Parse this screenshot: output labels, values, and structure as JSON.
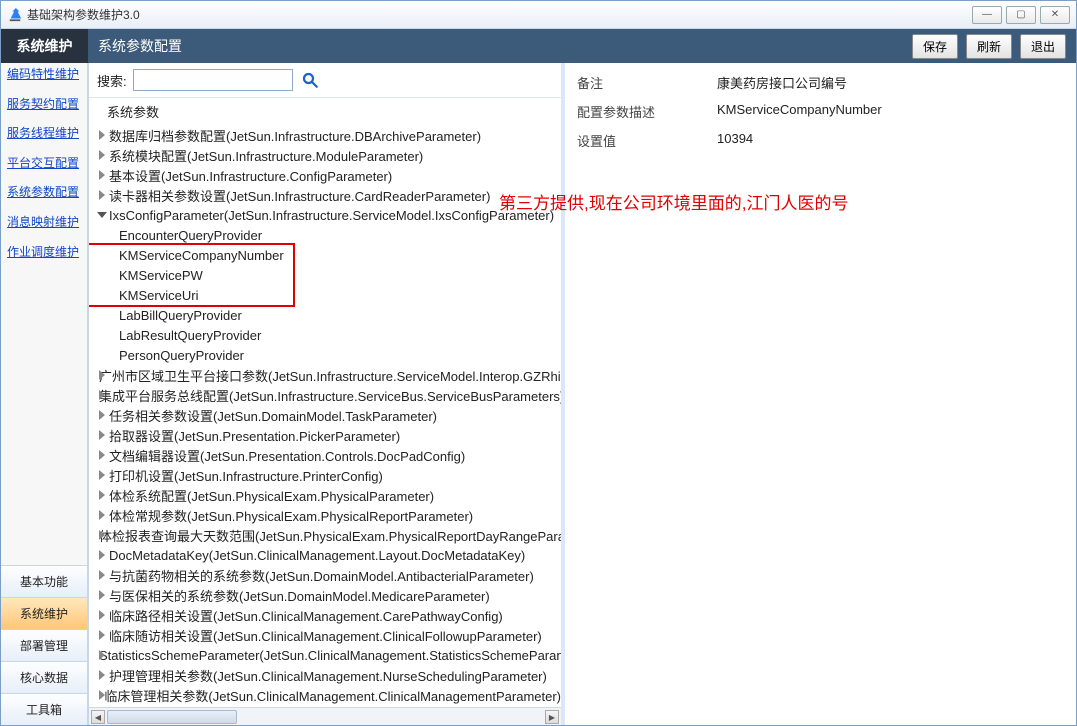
{
  "window": {
    "title": "基础架构参数维护3.0"
  },
  "header": {
    "section": "系统维护",
    "title": "系统参数配置",
    "buttons": {
      "save": "保存",
      "refresh": "刷新",
      "exit": "退出"
    }
  },
  "sidebar": {
    "links": [
      "编码特性维护",
      "服务契约配置",
      "服务线程维护",
      "平台交互配置",
      "系统参数配置",
      "消息映射维护",
      "作业调度维护"
    ],
    "tabs": [
      "基本功能",
      "系统维护",
      "部署管理",
      "核心数据",
      "工具箱"
    ],
    "active_tab_index": 1
  },
  "search": {
    "label": "搜索:",
    "value": ""
  },
  "tree": {
    "root_label": "系统参数",
    "nodes": [
      {
        "label": "数据库归档参数配置(JetSun.Infrastructure.DBArchiveParameter)",
        "expanded": false,
        "level": 1
      },
      {
        "label": "系统模块配置(JetSun.Infrastructure.ModuleParameter)",
        "expanded": false,
        "level": 1
      },
      {
        "label": "基本设置(JetSun.Infrastructure.ConfigParameter)",
        "expanded": false,
        "level": 1
      },
      {
        "label": "读卡器相关参数设置(JetSun.Infrastructure.CardReaderParameter)",
        "expanded": false,
        "level": 1
      },
      {
        "label": "IxsConfigParameter(JetSun.Infrastructure.ServiceModel.IxsConfigParameter)",
        "expanded": true,
        "level": 1,
        "children": [
          {
            "label": "EncounterQueryProvider",
            "level": 2
          },
          {
            "label": "KMServiceCompanyNumber",
            "level": 2
          },
          {
            "label": "KMServicePW",
            "level": 2
          },
          {
            "label": "KMServiceUri",
            "level": 2
          },
          {
            "label": "LabBillQueryProvider",
            "level": 2
          },
          {
            "label": "LabResultQueryProvider",
            "level": 2
          },
          {
            "label": "PersonQueryProvider",
            "level": 2
          }
        ]
      },
      {
        "label": "广州市区域卫生平台接口参数(JetSun.Infrastructure.ServiceModel.Interop.GZRhin",
        "expanded": false,
        "level": 1
      },
      {
        "label": "集成平台服务总线配置(JetSun.Infrastructure.ServiceBus.ServiceBusParameters)",
        "expanded": false,
        "level": 1
      },
      {
        "label": "任务相关参数设置(JetSun.DomainModel.TaskParameter)",
        "expanded": false,
        "level": 1
      },
      {
        "label": "拾取器设置(JetSun.Presentation.PickerParameter)",
        "expanded": false,
        "level": 1
      },
      {
        "label": "文档编辑器设置(JetSun.Presentation.Controls.DocPadConfig)",
        "expanded": false,
        "level": 1
      },
      {
        "label": "打印机设置(JetSun.Infrastructure.PrinterConfig)",
        "expanded": false,
        "level": 1
      },
      {
        "label": "体检系统配置(JetSun.PhysicalExam.PhysicalParameter)",
        "expanded": false,
        "level": 1
      },
      {
        "label": "体检常规参数(JetSun.PhysicalExam.PhysicalReportParameter)",
        "expanded": false,
        "level": 1
      },
      {
        "label": "体检报表查询最大天数范围(JetSun.PhysicalExam.PhysicalReportDayRangeParam",
        "expanded": false,
        "level": 1
      },
      {
        "label": "DocMetadataKey(JetSun.ClinicalManagement.Layout.DocMetadataKey)",
        "expanded": false,
        "level": 1
      },
      {
        "label": "与抗菌药物相关的系统参数(JetSun.DomainModel.AntibacterialParameter)",
        "expanded": false,
        "level": 1
      },
      {
        "label": "与医保相关的系统参数(JetSun.DomainModel.MedicareParameter)",
        "expanded": false,
        "level": 1
      },
      {
        "label": "临床路径相关设置(JetSun.ClinicalManagement.CarePathwayConfig)",
        "expanded": false,
        "level": 1
      },
      {
        "label": "临床随访相关设置(JetSun.ClinicalManagement.ClinicalFollowupParameter)",
        "expanded": false,
        "level": 1
      },
      {
        "label": "StatisticsSchemeParameter(JetSun.ClinicalManagement.StatisticsSchemeParan",
        "expanded": false,
        "level": 1
      },
      {
        "label": "护理管理相关参数(JetSun.ClinicalManagement.NurseSchedulingParameter)",
        "expanded": false,
        "level": 1
      },
      {
        "label": "临床管理相关参数(JetSun.ClinicalManagement.ClinicalManagementParameter)",
        "expanded": false,
        "level": 1
      }
    ]
  },
  "details": {
    "fields": [
      {
        "label": "备注",
        "value": "康美药房接口公司编号"
      },
      {
        "label": "配置参数描述",
        "value": "KMServiceCompanyNumber"
      },
      {
        "label": "设置值",
        "value": "10394"
      }
    ]
  },
  "annotation": "第三方提供,现在公司环境里面的,江门人医的号"
}
